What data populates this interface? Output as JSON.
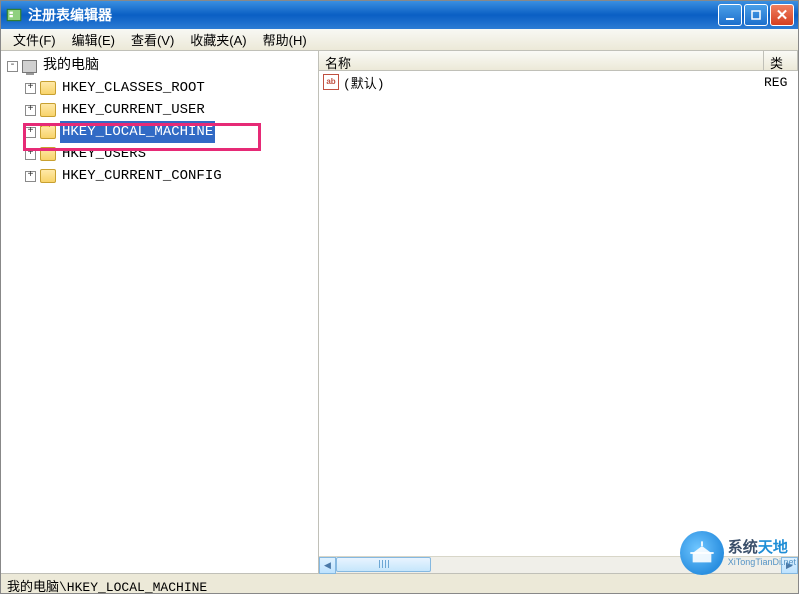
{
  "titlebar": {
    "title": "注册表编辑器"
  },
  "menu": {
    "file": "文件(F)",
    "edit": "编辑(E)",
    "view": "查看(V)",
    "favorites": "收藏夹(A)",
    "help": "帮助(H)"
  },
  "tree": {
    "root": {
      "label": "我的电脑",
      "expander": "-"
    },
    "items": [
      {
        "label": "HKEY_CLASSES_ROOT",
        "expander": "+",
        "selected": false
      },
      {
        "label": "HKEY_CURRENT_USER",
        "expander": "+",
        "selected": false
      },
      {
        "label": "HKEY_LOCAL_MACHINE",
        "expander": "+",
        "selected": true
      },
      {
        "label": "HKEY_USERS",
        "expander": "+",
        "selected": false
      },
      {
        "label": "HKEY_CURRENT_CONFIG",
        "expander": "+",
        "selected": false
      }
    ]
  },
  "list": {
    "columns": {
      "name": "名称",
      "type": "类"
    },
    "rows": [
      {
        "icon": "ab",
        "name": "(默认)",
        "type": "REG"
      }
    ]
  },
  "statusbar": {
    "path": "我的电脑\\HKEY_LOCAL_MACHINE"
  },
  "watermark": {
    "brand1": "系统",
    "brand2": "天地",
    "url": "XiTongTianDi.net"
  }
}
